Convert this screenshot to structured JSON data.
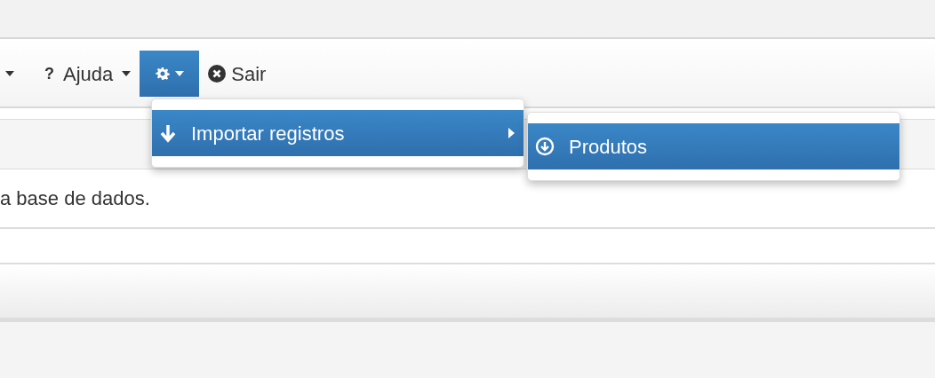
{
  "toolbar": [
    {
      "kind": "caret",
      "active": false
    },
    {
      "kind": "dropdown",
      "icon": "?",
      "label": "Ajuda",
      "active": false
    },
    {
      "kind": "gear",
      "active": true
    },
    {
      "kind": "link",
      "label": "Sair",
      "active": false
    }
  ],
  "menu": {
    "items": [
      {
        "label": "Importar registros",
        "selected": true,
        "has_submenu": true
      }
    ]
  },
  "submenu": {
    "items": [
      {
        "label": "Produtos",
        "selected": true
      }
    ]
  },
  "content": {
    "text": "a base de dados."
  }
}
